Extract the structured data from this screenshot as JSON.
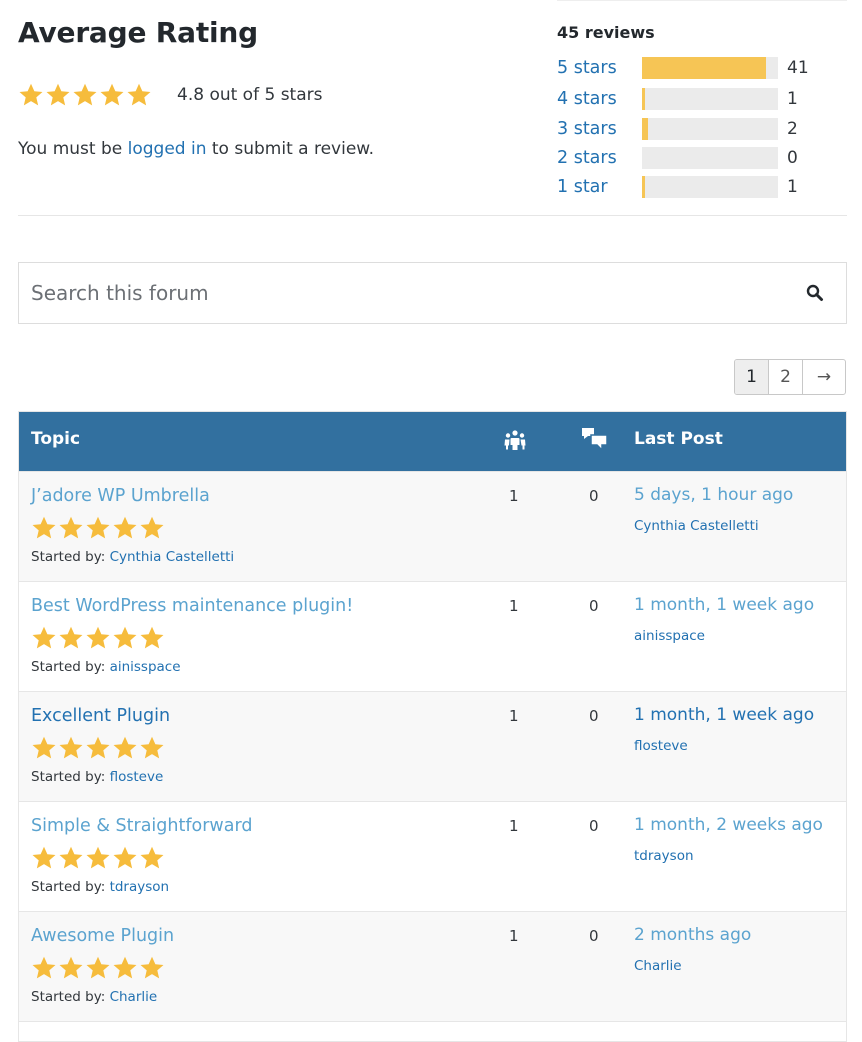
{
  "colors": {
    "star": "#f6bc3c",
    "header_bg": "#32709f",
    "link": "#2271b1",
    "link_light": "#5ba3cf",
    "bar_fill": "#f6c555",
    "bar_track": "#ebebeb"
  },
  "rating": {
    "title": "Average Rating",
    "stars_filled": 5,
    "summary": "4.8 out of 5 stars",
    "login_prefix": "You must be ",
    "login_link": "logged in",
    "login_suffix": " to submit a review."
  },
  "reviews": {
    "count_label": "45 reviews",
    "total": 45,
    "breakdown": [
      {
        "label": "5 stars",
        "count": "41",
        "value": 41
      },
      {
        "label": "4 stars",
        "count": "1",
        "value": 1
      },
      {
        "label": "3 stars",
        "count": "2",
        "value": 2
      },
      {
        "label": "2 stars",
        "count": "0",
        "value": 0
      },
      {
        "label": "1 star",
        "count": "1",
        "value": 1
      }
    ]
  },
  "search": {
    "placeholder": "Search this forum",
    "value": "",
    "button_icon": "search-icon"
  },
  "pagination": {
    "pages": [
      "1",
      "2"
    ],
    "current": "1",
    "next_label": "→"
  },
  "table": {
    "headers": {
      "topic": "Topic",
      "voices_icon": "voices-icon",
      "replies_icon": "replies-icon",
      "last_post": "Last Post"
    },
    "started_by_label": "Started by: ",
    "rows": [
      {
        "title": "J’adore WP Umbrella",
        "stars": 5,
        "author": "Cynthia Castelletti",
        "voices": "1",
        "replies": "0",
        "last_post_time": "5 days, 1 hour ago",
        "last_post_author": "Cynthia Castelletti"
      },
      {
        "title": "Best WordPress maintenance plugin!",
        "stars": 5,
        "author": "ainisspace",
        "voices": "1",
        "replies": "0",
        "last_post_time": "1 month, 1 week ago",
        "last_post_author": "ainisspace"
      },
      {
        "title": "Excellent Plugin",
        "stars": 5,
        "author": "flosteve",
        "voices": "1",
        "replies": "0",
        "last_post_time": "1 month, 1 week ago",
        "last_post_author": "flosteve"
      },
      {
        "title": "Simple & Straightforward",
        "stars": 5,
        "author": "tdrayson",
        "voices": "1",
        "replies": "0",
        "last_post_time": "1 month, 2 weeks ago",
        "last_post_author": "tdrayson"
      },
      {
        "title": "Awesome Plugin",
        "stars": 5,
        "author": "Charlie",
        "voices": "1",
        "replies": "0",
        "last_post_time": "2 months ago",
        "last_post_author": "Charlie"
      }
    ]
  }
}
